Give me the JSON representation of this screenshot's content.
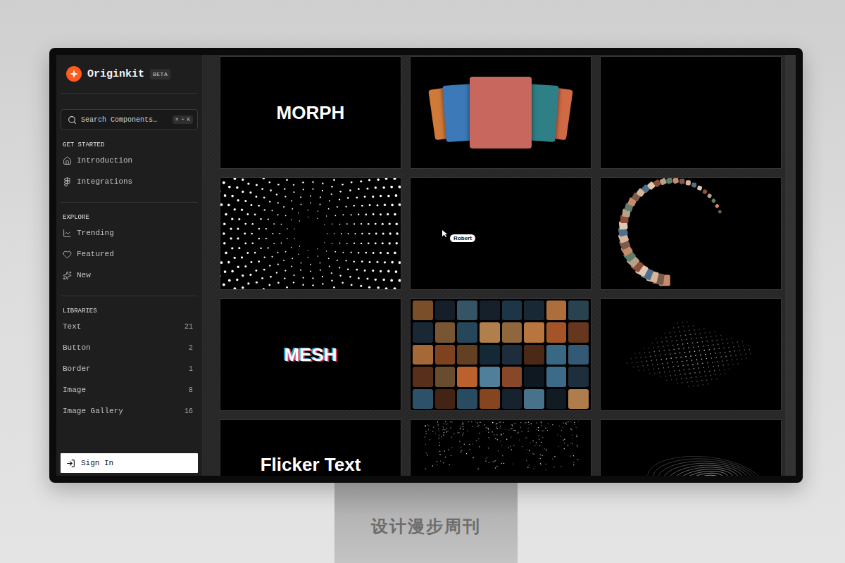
{
  "sidebar": {
    "brand": "Originkit",
    "badge": "BETA",
    "search": {
      "placeholder": "Search Components…",
      "shortcut": "⌘ + K"
    },
    "sections": [
      {
        "title": "GET STARTED",
        "items": [
          {
            "label": "Introduction"
          },
          {
            "label": "Integrations"
          }
        ]
      },
      {
        "title": "EXPLORE",
        "items": [
          {
            "label": "Trending"
          },
          {
            "label": "Featured"
          },
          {
            "label": "New"
          }
        ]
      },
      {
        "title": "LIBRARIES",
        "items": [
          {
            "label": "Text",
            "count": "21"
          },
          {
            "label": "Button",
            "count": "2"
          },
          {
            "label": "Border",
            "count": "1"
          },
          {
            "label": "Image",
            "count": "8"
          },
          {
            "label": "Image Gallery",
            "count": "16"
          }
        ]
      }
    ],
    "sign_in": "Sign In"
  },
  "cards": [
    {
      "kind": "text",
      "label": "MORPH"
    },
    {
      "kind": "photo-stack"
    },
    {
      "kind": "empty"
    },
    {
      "kind": "dot-rings"
    },
    {
      "kind": "cursor",
      "label": "Robert"
    },
    {
      "kind": "photo-ring"
    },
    {
      "kind": "glitch-text",
      "label": "MESH"
    },
    {
      "kind": "mosaic"
    },
    {
      "kind": "dot-grid"
    },
    {
      "kind": "low-text",
      "label": "Flicker Text"
    },
    {
      "kind": "particles"
    },
    {
      "kind": "swirl"
    }
  ],
  "watermark": "设计漫步周刊"
}
